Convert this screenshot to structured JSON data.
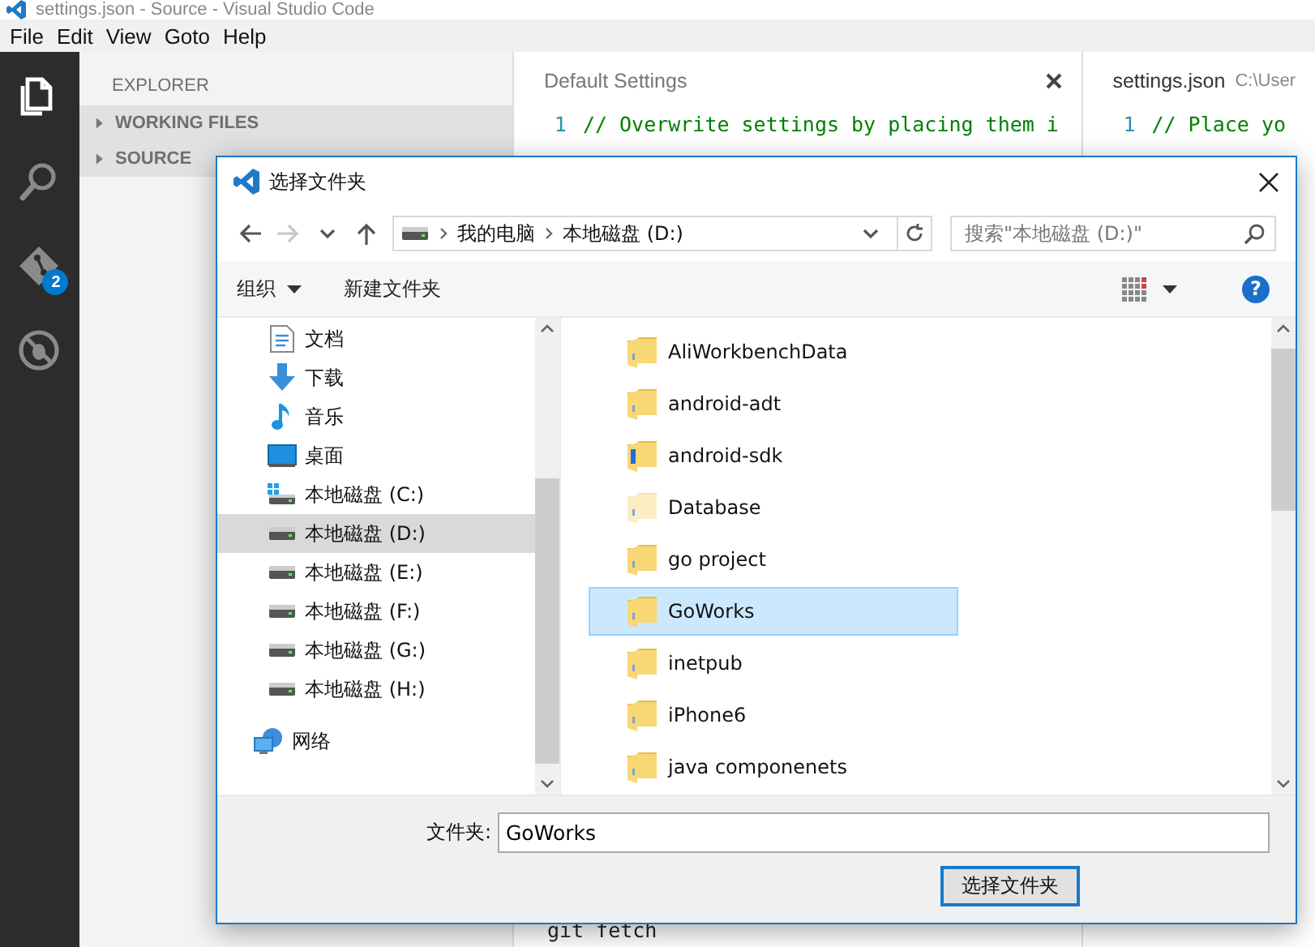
{
  "window": {
    "title": "settings.json - Source - Visual Studio Code"
  },
  "menu": [
    "File",
    "Edit",
    "View",
    "Goto",
    "Help"
  ],
  "activity_bar": [
    {
      "kind": "files",
      "selected": true
    },
    {
      "kind": "search",
      "selected": false
    },
    {
      "kind": "git",
      "selected": false,
      "badge": "2"
    },
    {
      "kind": "debug",
      "selected": false
    }
  ],
  "sidebar": {
    "title": "EXPLORER",
    "sections": [
      {
        "label": "WORKING FILES",
        "expanded": false
      },
      {
        "label": "SOURCE",
        "expanded": false
      }
    ]
  },
  "editors": [
    {
      "tab": "Default Settings",
      "closable": true,
      "lines": [
        {
          "number": "1",
          "text": "// Overwrite settings by placing them i",
          "kind": "comment"
        }
      ]
    },
    {
      "tab": "settings.json",
      "path": "C:\\User",
      "closable": false,
      "lines": [
        {
          "number": "1",
          "text": "// Place yo",
          "kind": "comment"
        }
      ]
    }
  ],
  "panel": {
    "lines": [
      "git fetch"
    ]
  },
  "dialog": {
    "title": "选择文件夹",
    "nav": [
      {
        "kind": "back",
        "disabled": false
      },
      {
        "kind": "forward",
        "disabled": true
      },
      {
        "kind": "recent",
        "disabled": false
      },
      {
        "kind": "up",
        "disabled": false
      }
    ],
    "address": {
      "segments": [
        "我的电脑",
        "本地磁盘 (D:)"
      ]
    },
    "search": {
      "placeholder": "搜索\"本地磁盘 (D:)\""
    },
    "toolbar": {
      "organize": "组织",
      "new_folder": "新建文件夹",
      "help": "?"
    },
    "tree": [
      {
        "label": "文档",
        "kind": "documents",
        "selected": false
      },
      {
        "label": "下载",
        "kind": "downloads",
        "selected": false
      },
      {
        "label": "音乐",
        "kind": "music",
        "selected": false
      },
      {
        "label": "桌面",
        "kind": "desktop",
        "selected": false
      },
      {
        "label": "本地磁盘 (C:)",
        "kind": "system-drive",
        "selected": false
      },
      {
        "label": "本地磁盘 (D:)",
        "kind": "drive",
        "selected": true
      },
      {
        "label": "本地磁盘 (E:)",
        "kind": "drive",
        "selected": false
      },
      {
        "label": "本地磁盘 (F:)",
        "kind": "drive",
        "selected": false
      },
      {
        "label": "本地磁盘 (G:)",
        "kind": "drive",
        "selected": false
      },
      {
        "label": "本地磁盘 (H:)",
        "kind": "drive",
        "selected": false
      },
      {
        "label": "网络",
        "kind": "network",
        "selected": false
      }
    ],
    "files": [
      {
        "name": "AliWorkbenchData",
        "kind": "folder",
        "selected": false
      },
      {
        "name": "android-adt",
        "kind": "folder",
        "selected": false
      },
      {
        "name": "android-sdk",
        "kind": "folder-with-file",
        "selected": false
      },
      {
        "name": "Database",
        "kind": "folder-light",
        "selected": false
      },
      {
        "name": "go project",
        "kind": "folder",
        "selected": false
      },
      {
        "name": "GoWorks",
        "kind": "folder",
        "selected": true
      },
      {
        "name": "inetpub",
        "kind": "folder",
        "selected": false
      },
      {
        "name": "iPhone6",
        "kind": "folder",
        "selected": false
      },
      {
        "name": "java componenets",
        "kind": "folder",
        "selected": false
      }
    ],
    "folder_field": {
      "label": "文件夹:",
      "value": "GoWorks"
    },
    "buttons": [
      "选择文件夹"
    ]
  }
}
